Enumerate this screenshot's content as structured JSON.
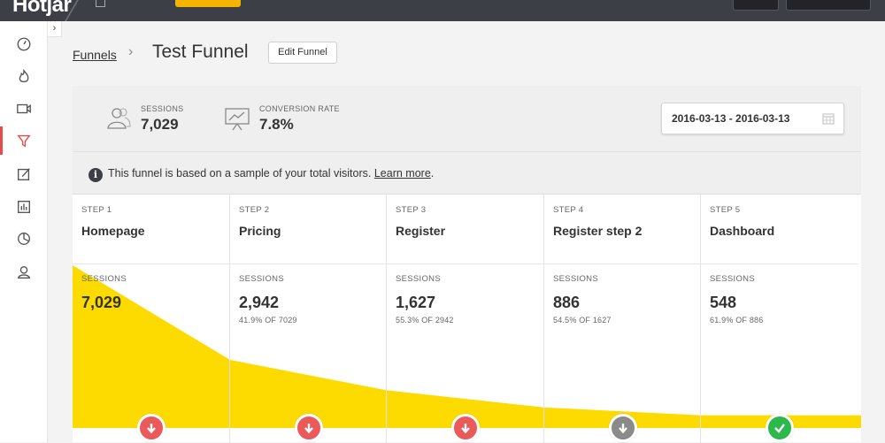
{
  "topbar": {
    "logo": "Hotjar"
  },
  "sidebar": {
    "toggle_glyph": "›",
    "items": [
      {
        "icon": "dashboard-icon",
        "active": false
      },
      {
        "icon": "heatmaps-icon",
        "active": false
      },
      {
        "icon": "recordings-icon",
        "active": false
      },
      {
        "icon": "funnels-icon",
        "active": true
      },
      {
        "icon": "forms-icon",
        "active": false
      },
      {
        "icon": "analytics-icon",
        "active": false
      },
      {
        "icon": "polls-icon",
        "active": false
      },
      {
        "icon": "recruiters-icon",
        "active": false
      }
    ]
  },
  "breadcrumb": {
    "parent": "Funnels",
    "separator": "›",
    "title": "Test Funnel"
  },
  "edit_button": "Edit Funnel",
  "stats": {
    "sessions_label": "SESSIONS",
    "sessions_value": "7,029",
    "conversion_label": "CONVERSION RATE",
    "conversion_value": "7.8%"
  },
  "date_range": "2016-03-13 - 2016-03-13",
  "notice": {
    "info_glyph": "i",
    "text": "This funnel is based on a sample of your total visitors. ",
    "link": "Learn more",
    "trailing": "."
  },
  "colors": {
    "funnel_fill": "#fedb00",
    "drop_red": "#eb5a5a",
    "drop_gray": "#8a8a8a",
    "success_green": "#2db84c",
    "active_red": "#e84a4a"
  },
  "steps": [
    {
      "num": "STEP 1",
      "name": "Homepage",
      "sess_label": "SESSIONS",
      "sessions": "7,029",
      "pct": "",
      "badge": "down",
      "badge_color": "red"
    },
    {
      "num": "STEP 2",
      "name": "Pricing",
      "sess_label": "SESSIONS",
      "sessions": "2,942",
      "pct": "41.9% OF 7029",
      "badge": "down",
      "badge_color": "red"
    },
    {
      "num": "STEP 3",
      "name": "Register",
      "sess_label": "SESSIONS",
      "sessions": "1,627",
      "pct": "55.3% OF 2942",
      "badge": "down",
      "badge_color": "red"
    },
    {
      "num": "STEP 4",
      "name": "Register step 2",
      "sess_label": "SESSIONS",
      "sessions": "886",
      "pct": "54.5% OF 1627",
      "badge": "down",
      "badge_color": "gray"
    },
    {
      "num": "STEP 5",
      "name": "Dashboard",
      "sess_label": "SESSIONS",
      "sessions": "548",
      "pct": "61.9% OF 886",
      "badge": "check",
      "badge_color": "green"
    }
  ],
  "chart_data": {
    "type": "area",
    "categories": [
      "Homepage",
      "Pricing",
      "Register",
      "Register step 2",
      "Dashboard"
    ],
    "values": [
      7029,
      2942,
      1627,
      886,
      548
    ]
  }
}
